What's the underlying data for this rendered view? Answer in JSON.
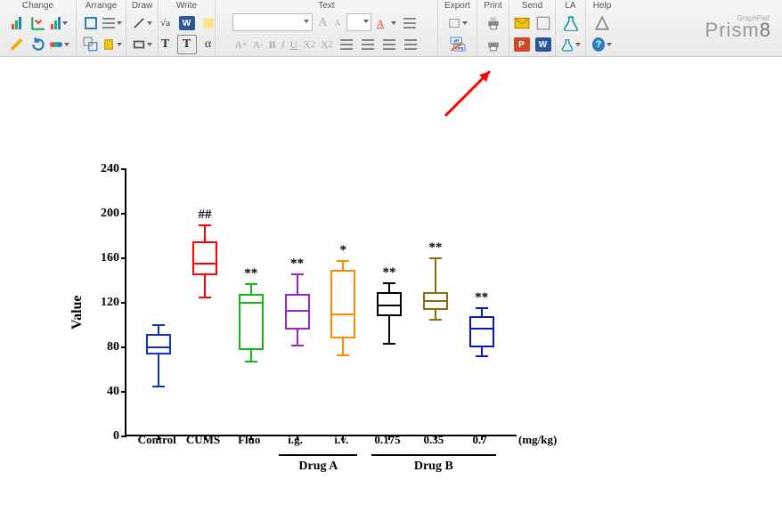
{
  "toolbar": {
    "groups": {
      "change": {
        "title": "Change"
      },
      "arrange": {
        "title": "Arrange"
      },
      "draw": {
        "title": "Draw"
      },
      "write": {
        "title": "Write"
      },
      "text": {
        "title": "Text",
        "fmt_buttons": [
          "A",
          "A",
          "B",
          "I",
          "U",
          "X",
          "X",
          "A",
          "A"
        ]
      },
      "export": {
        "title": "Export"
      },
      "print": {
        "title": "Print"
      },
      "send": {
        "title": "Send",
        "ppt": "P",
        "wrd": "W"
      },
      "la": {
        "title": "LA"
      },
      "help": {
        "title": "Help"
      }
    },
    "sqrt": "√a",
    "w_badge": "W",
    "T1": "T",
    "T2": "T",
    "font_value": "",
    "size_value": ""
  },
  "brand": {
    "small": "GraphPad",
    "name": "Prism",
    "ver": "8"
  },
  "chart_data": {
    "type": "box",
    "ylabel": "Value",
    "ylim": [
      0,
      240
    ],
    "yticks": [
      0,
      40,
      80,
      120,
      160,
      200,
      240
    ],
    "x_unit": "(mg/kg)",
    "categories": [
      "Control",
      "CUMS",
      "Fluo",
      "i.g.",
      "i.v.",
      "0.175",
      "0.35",
      "0.7"
    ],
    "sub_groups": [
      {
        "label": "Drug A",
        "span": [
          3,
          4
        ]
      },
      {
        "label": "Drug B",
        "span": [
          5,
          7
        ]
      }
    ],
    "series": [
      {
        "name": "Control",
        "color": "#1034c9",
        "min": 45,
        "q1": 74,
        "median": 80,
        "q3": 92,
        "max": 100,
        "sig": ""
      },
      {
        "name": "CUMS",
        "color": "#ff0000",
        "min": 125,
        "q1": 145,
        "median": 155,
        "q3": 175,
        "max": 190,
        "sig": "##"
      },
      {
        "name": "Fluo",
        "color": "#17b41a",
        "min": 67,
        "q1": 78,
        "median": 120,
        "q3": 128,
        "max": 137,
        "sig": "**"
      },
      {
        "name": "i.g.",
        "color": "#9b25c5",
        "min": 82,
        "q1": 96,
        "median": 113,
        "q3": 128,
        "max": 146,
        "sig": "**"
      },
      {
        "name": "i.v.",
        "color": "#ff8a00",
        "min": 73,
        "q1": 88,
        "median": 110,
        "q3": 150,
        "max": 158,
        "sig": "*"
      },
      {
        "name": "0.175",
        "color": "#000000",
        "min": 83,
        "q1": 108,
        "median": 118,
        "q3": 130,
        "max": 138,
        "sig": "**"
      },
      {
        "name": "0.35",
        "color": "#8a6b11",
        "min": 105,
        "q1": 114,
        "median": 122,
        "q3": 130,
        "max": 160,
        "sig": "**"
      },
      {
        "name": "0.7",
        "color": "#0815c1",
        "min": 72,
        "q1": 80,
        "median": 97,
        "q3": 108,
        "max": 115,
        "sig": "**"
      }
    ]
  }
}
